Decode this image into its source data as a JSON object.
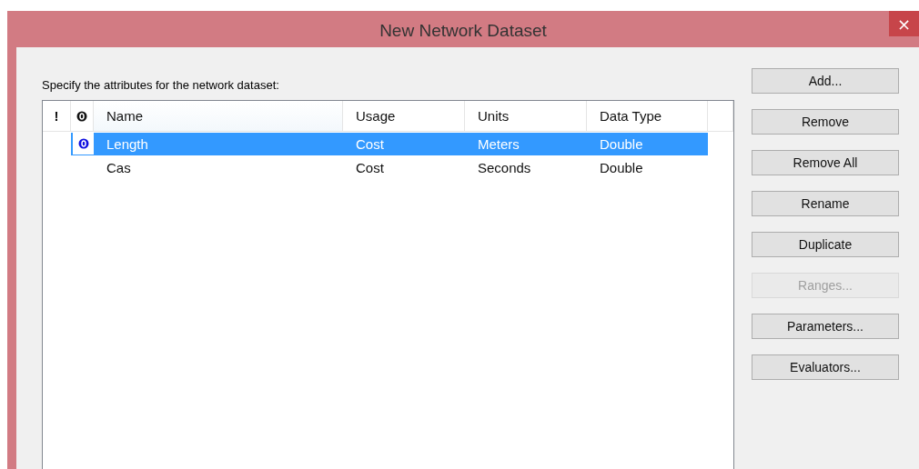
{
  "window": {
    "title": "New Network Dataset",
    "close": "×"
  },
  "prompt": "Specify the attributes for the network dataset:",
  "table": {
    "marker_columns": [
      {
        "kind": "text",
        "label": "!"
      },
      {
        "kind": "icon"
      }
    ],
    "columns": [
      "Name",
      "Usage",
      "Units",
      "Data Type"
    ],
    "rows": [
      {
        "default": true,
        "selected": true,
        "cells": [
          "Length",
          "Cost",
          "Meters",
          "Double"
        ]
      },
      {
        "default": false,
        "selected": false,
        "cells": [
          "Cas",
          "Cost",
          "Seconds",
          "Double"
        ]
      }
    ]
  },
  "buttons": [
    {
      "label": "Add...",
      "disabled": false
    },
    {
      "label": "Remove",
      "disabled": false
    },
    {
      "label": "Remove All",
      "disabled": false
    },
    {
      "label": "Rename",
      "disabled": false
    },
    {
      "label": "Duplicate",
      "disabled": false
    },
    {
      "label": "Ranges...",
      "disabled": true
    },
    {
      "label": "Parameters...",
      "disabled": false
    },
    {
      "label": "Evaluators...",
      "disabled": false
    }
  ]
}
